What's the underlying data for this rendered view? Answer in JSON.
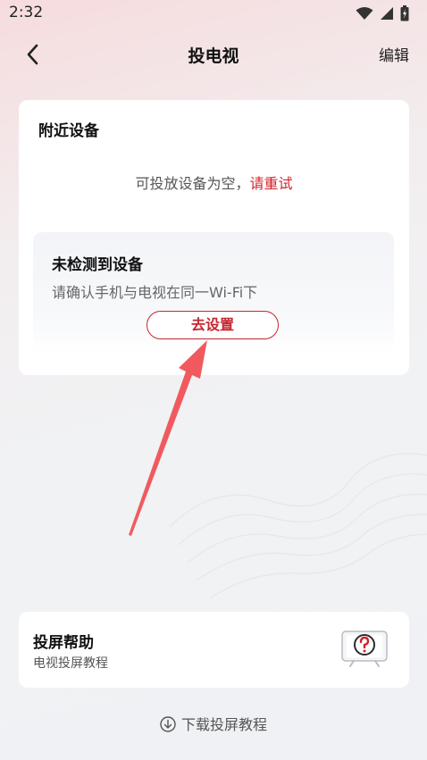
{
  "status": {
    "time": "2:32"
  },
  "nav": {
    "title": "投电视",
    "edit_label": "编辑"
  },
  "nearby": {
    "title": "附近设备",
    "empty_text": "可投放设备为空，",
    "retry_label": "请重试"
  },
  "no_device": {
    "title": "未检测到设备",
    "description": "请确认手机与电视在同一Wi-Fi下",
    "setup_label": "去设置"
  },
  "help": {
    "title": "投屏帮助",
    "subtitle": "电视投屏教程"
  },
  "download": {
    "label": "下载投屏教程"
  },
  "colors": {
    "accent": "#c4262e",
    "arrow": "#f05a5f"
  }
}
